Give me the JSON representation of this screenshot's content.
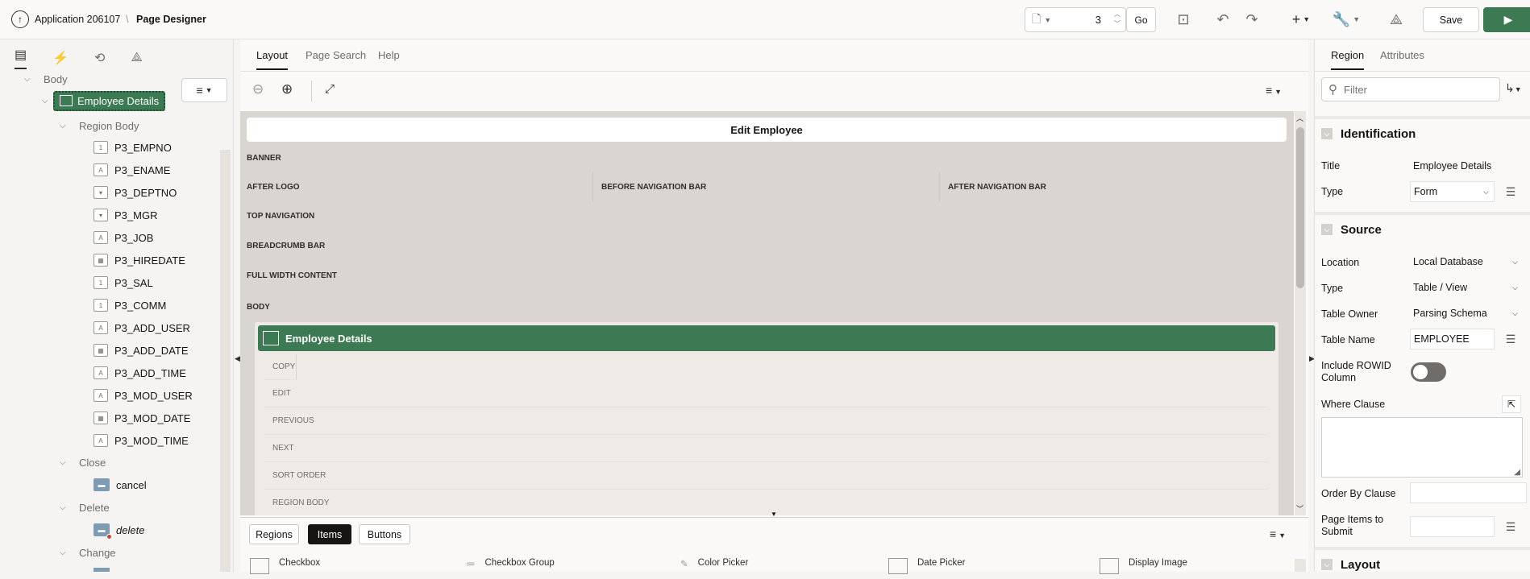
{
  "header": {
    "app_label": "Application 206107",
    "separator": "\\",
    "page_label": "Page Designer",
    "page_number": "3",
    "go_label": "Go",
    "save_label": "Save"
  },
  "tree": {
    "body_label": "Body",
    "region_label": "Employee Details",
    "region_body_label": "Region Body",
    "items": [
      {
        "name": "P3_EMPNO",
        "icon": "number-field-icon",
        "glyph": "1"
      },
      {
        "name": "P3_ENAME",
        "icon": "text-field-icon",
        "glyph": "A"
      },
      {
        "name": "P3_DEPTNO",
        "icon": "select-list-icon",
        "glyph": "▾"
      },
      {
        "name": "P3_MGR",
        "icon": "select-list-icon",
        "glyph": "▾"
      },
      {
        "name": "P3_JOB",
        "icon": "text-field-icon",
        "glyph": "A"
      },
      {
        "name": "P3_HIREDATE",
        "icon": "date-picker-icon",
        "glyph": "▦"
      },
      {
        "name": "P3_SAL",
        "icon": "number-field-icon",
        "glyph": "1"
      },
      {
        "name": "P3_COMM",
        "icon": "number-field-icon",
        "glyph": "1"
      },
      {
        "name": "P3_ADD_USER",
        "icon": "text-field-icon",
        "glyph": "A"
      },
      {
        "name": "P3_ADD_DATE",
        "icon": "date-picker-icon",
        "glyph": "▦"
      },
      {
        "name": "P3_ADD_TIME",
        "icon": "text-field-icon",
        "glyph": "A"
      },
      {
        "name": "P3_MOD_USER",
        "icon": "text-field-icon",
        "glyph": "A"
      },
      {
        "name": "P3_MOD_DATE",
        "icon": "date-picker-icon",
        "glyph": "▦"
      },
      {
        "name": "P3_MOD_TIME",
        "icon": "text-field-icon",
        "glyph": "A"
      }
    ],
    "close_label": "Close",
    "cancel_label": "cancel",
    "delete_group_label": "Delete",
    "delete_label": "delete",
    "change_label": "Change"
  },
  "layout": {
    "tabs": [
      "Layout",
      "Page Search",
      "Help"
    ],
    "page_title": "Edit Employee",
    "positions": {
      "banner": "BANNER",
      "after_logo": "AFTER LOGO",
      "before_nav": "BEFORE NAVIGATION BAR",
      "after_nav": "AFTER NAVIGATION BAR",
      "top_nav": "TOP NAVIGATION",
      "breadcrumb": "BREADCRUMB BAR",
      "full_width": "FULL WIDTH CONTENT",
      "body": "BODY"
    },
    "region_title": "Employee Details",
    "region_slots": [
      "COPY",
      "EDIT",
      "PREVIOUS",
      "NEXT",
      "SORT ORDER",
      "REGION BODY"
    ],
    "gallery_tabs": [
      "Regions",
      "Items",
      "Buttons"
    ],
    "gallery_items": [
      "Checkbox",
      "Checkbox Group",
      "Color Picker",
      "Date Picker",
      "Display Image"
    ]
  },
  "properties": {
    "tabs": [
      "Region",
      "Attributes"
    ],
    "filter_placeholder": "Filter",
    "identification": "Identification",
    "title_label": "Title",
    "title_value": "Employee Details",
    "type_label": "Type",
    "type_value": "Form",
    "source": "Source",
    "location_label": "Location",
    "location_value": "Local Database",
    "source_type_label": "Type",
    "source_type_value": "Table / View",
    "table_owner_label": "Table Owner",
    "table_owner_value": "Parsing Schema",
    "table_name_label": "Table Name",
    "table_name_value": "EMPLOYEE",
    "rowid_label": "Include ROWID Column",
    "where_label": "Where Clause",
    "order_by_label": "Order By Clause",
    "page_items_label": "Page Items to Submit",
    "layout_section": "Layout"
  },
  "colors": {
    "accent_green": "#3c7a54",
    "dark": "#161513"
  }
}
